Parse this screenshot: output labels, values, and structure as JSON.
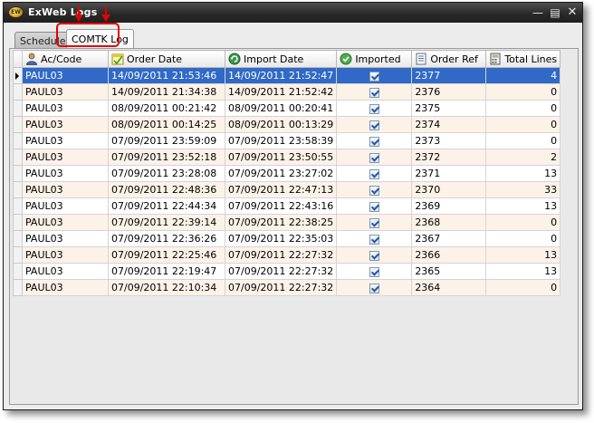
{
  "window": {
    "title": "ExWeb Logs"
  },
  "tabs": [
    {
      "label": "Schedule"
    },
    {
      "label": "COMTK Log"
    }
  ],
  "grid": {
    "columns": [
      "Ac/Code",
      "Order Date",
      "Import Date",
      "Imported",
      "Order Ref",
      "Total Lines"
    ],
    "rows": [
      {
        "ac": "PAUL03",
        "order_date": "14/09/2011 21:53:46",
        "import_date": "14/09/2011 21:52:47",
        "imported": true,
        "order_ref": "2377",
        "total_lines": "4"
      },
      {
        "ac": "PAUL03",
        "order_date": "14/09/2011 21:34:38",
        "import_date": "14/09/2011 21:52:42",
        "imported": true,
        "order_ref": "2376",
        "total_lines": "0"
      },
      {
        "ac": "PAUL03",
        "order_date": "08/09/2011 00:21:42",
        "import_date": "08/09/2011 00:20:41",
        "imported": true,
        "order_ref": "2375",
        "total_lines": "0"
      },
      {
        "ac": "PAUL03",
        "order_date": "08/09/2011 00:14:25",
        "import_date": "08/09/2011 00:13:29",
        "imported": true,
        "order_ref": "2374",
        "total_lines": "0"
      },
      {
        "ac": "PAUL03",
        "order_date": "07/09/2011 23:59:09",
        "import_date": "07/09/2011 23:58:39",
        "imported": true,
        "order_ref": "2373",
        "total_lines": "0"
      },
      {
        "ac": "PAUL03",
        "order_date": "07/09/2011 23:52:18",
        "import_date": "07/09/2011 23:50:55",
        "imported": true,
        "order_ref": "2372",
        "total_lines": "2"
      },
      {
        "ac": "PAUL03",
        "order_date": "07/09/2011 23:28:08",
        "import_date": "07/09/2011 23:27:02",
        "imported": true,
        "order_ref": "2371",
        "total_lines": "13"
      },
      {
        "ac": "PAUL03",
        "order_date": "07/09/2011 22:48:36",
        "import_date": "07/09/2011 22:47:13",
        "imported": true,
        "order_ref": "2370",
        "total_lines": "33"
      },
      {
        "ac": "PAUL03",
        "order_date": "07/09/2011 22:44:34",
        "import_date": "07/09/2011 22:43:16",
        "imported": true,
        "order_ref": "2369",
        "total_lines": "13"
      },
      {
        "ac": "PAUL03",
        "order_date": "07/09/2011 22:39:14",
        "import_date": "07/09/2011 22:38:25",
        "imported": true,
        "order_ref": "2368",
        "total_lines": "0"
      },
      {
        "ac": "PAUL03",
        "order_date": "07/09/2011 22:36:26",
        "import_date": "07/09/2011 22:35:03",
        "imported": true,
        "order_ref": "2367",
        "total_lines": "0"
      },
      {
        "ac": "PAUL03",
        "order_date": "07/09/2011 22:25:46",
        "import_date": "07/09/2011 22:27:32",
        "imported": true,
        "order_ref": "2366",
        "total_lines": "13"
      },
      {
        "ac": "PAUL03",
        "order_date": "07/09/2011 22:19:47",
        "import_date": "07/09/2011 22:27:32",
        "imported": true,
        "order_ref": "2365",
        "total_lines": "13"
      },
      {
        "ac": "PAUL03",
        "order_date": "07/09/2011 22:10:34",
        "import_date": "07/09/2011 22:27:32",
        "imported": true,
        "order_ref": "2364",
        "total_lines": "0"
      }
    ]
  },
  "colors": {
    "selection": "#3169c6",
    "alt_row": "#fdf2e8",
    "annotation": "#e60000"
  }
}
